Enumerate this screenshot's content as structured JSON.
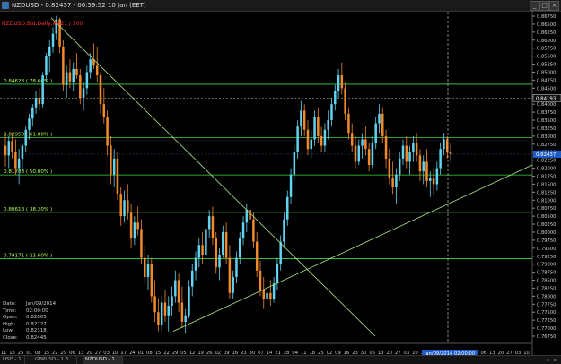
{
  "window": {
    "title": "NZDUSD - 0.82437 - 06:59:52  10 Jan (EET)",
    "controls": [
      "_",
      "□",
      "×"
    ]
  },
  "indicator": {
    "label": "NZDUSD,Bid,Daily,#221 / 300"
  },
  "colors": {
    "background": "#000000",
    "candle_up": "#5fd3ef",
    "candle_down": "#f08a2a",
    "fib_line": "#42d842",
    "fib_label": "#b6ff5a",
    "trendline": "#b0e48c",
    "axis_text": "#d0d0d0",
    "price_marker_bg": "#1d5cc9"
  },
  "fib_levels": [
    {
      "label": "0.84623 ( 78.60% )",
      "price": 0.84623
    },
    {
      "label": "0.82950 ( 61.80% )",
      "price": 0.8295
    },
    {
      "label": "0.81788 ( 50.00% )",
      "price": 0.81788
    },
    {
      "label": "0.80618 ( 38.20% )",
      "price": 0.80618
    },
    {
      "label": "0.79171 ( 23.60% )",
      "price": 0.79171
    }
  ],
  "price_axis": {
    "ticks": [
      "0.86750",
      "0.86500",
      "0.86250",
      "0.86000",
      "0.85750",
      "0.85500",
      "0.85250",
      "0.85000",
      "0.84750",
      "0.84500",
      "0.84250",
      "0.84000",
      "0.83750",
      "0.83500",
      "0.83250",
      "0.83000",
      "0.82750",
      "0.82500",
      "0.82250",
      "0.82000",
      "0.81750",
      "0.81500",
      "0.81250",
      "0.81000",
      "0.80750",
      "0.80500",
      "0.80250",
      "0.80000",
      "0.79750",
      "0.79500",
      "0.79250",
      "0.79000",
      "0.78750",
      "0.78500",
      "0.78250",
      "0.78000",
      "0.77750",
      "0.77500",
      "0.77250",
      "0.77000",
      "0.76750"
    ],
    "marker_upper": "0.84193",
    "marker_current": "0.82437"
  },
  "time_axis": {
    "labels": [
      "11",
      "18",
      "25",
      "01",
      "08",
      "15",
      "22",
      "29",
      "06",
      "13",
      "20",
      "27",
      "03",
      "10",
      "17",
      "24",
      "01",
      "08",
      "15",
      "22",
      "29",
      "05",
      "12",
      "19",
      "26",
      "02",
      "09",
      "16",
      "23",
      "30",
      "07",
      "14",
      "21",
      "28",
      "04",
      "11",
      "18",
      "25",
      "02",
      "09",
      "16",
      "23",
      "30",
      "06",
      "13",
      "20",
      "27",
      "03",
      "10",
      "17",
      "24",
      "01",
      "08",
      "15",
      "22",
      "29",
      "06",
      "13",
      "20",
      "27",
      "03",
      "10"
    ],
    "months": [
      "Jul/08",
      "Aug/05",
      "Sep/02",
      "Oct/07",
      "Nov/04",
      "Dec/02",
      "Jan/06/14",
      "Feb/03",
      "Mar/03"
    ],
    "cursor_label": "Jan/09/2014 02:00:00"
  },
  "data_box": [
    {
      "key": "Date:",
      "value": "Jan/09/2014"
    },
    {
      "key": "Time:",
      "value": "02:00:00"
    },
    {
      "key": "Open:",
      "value": "0.82605"
    },
    {
      "key": "High:",
      "value": "0.82727"
    },
    {
      "key": "Low:",
      "value": "0.82318"
    },
    {
      "key": "Close:",
      "value": "0.82445"
    }
  ],
  "tabs": [
    "USD - 1",
    "GBPUSD - 1.6...",
    "NZDUSD - 1..."
  ],
  "candles": [
    {
      "o": 0.827,
      "h": 0.8308,
      "l": 0.8205,
      "c": 0.824
    },
    {
      "o": 0.824,
      "h": 0.83,
      "l": 0.82,
      "c": 0.8285
    },
    {
      "o": 0.8285,
      "h": 0.831,
      "l": 0.823,
      "c": 0.825
    },
    {
      "o": 0.825,
      "h": 0.829,
      "l": 0.818,
      "c": 0.82
    },
    {
      "o": 0.82,
      "h": 0.826,
      "l": 0.815,
      "c": 0.823
    },
    {
      "o": 0.823,
      "h": 0.828,
      "l": 0.819,
      "c": 0.827
    },
    {
      "o": 0.827,
      "h": 0.833,
      "l": 0.825,
      "c": 0.832
    },
    {
      "o": 0.832,
      "h": 0.837,
      "l": 0.829,
      "c": 0.8355
    },
    {
      "o": 0.8355,
      "h": 0.84,
      "l": 0.833,
      "c": 0.839
    },
    {
      "o": 0.839,
      "h": 0.844,
      "l": 0.837,
      "c": 0.842
    },
    {
      "o": 0.842,
      "h": 0.845,
      "l": 0.838,
      "c": 0.84
    },
    {
      "o": 0.84,
      "h": 0.85,
      "l": 0.839,
      "c": 0.849
    },
    {
      "o": 0.849,
      "h": 0.856,
      "l": 0.847,
      "c": 0.855
    },
    {
      "o": 0.855,
      "h": 0.86,
      "l": 0.85,
      "c": 0.858
    },
    {
      "o": 0.858,
      "h": 0.864,
      "l": 0.856,
      "c": 0.862
    },
    {
      "o": 0.862,
      "h": 0.8676,
      "l": 0.86,
      "c": 0.8665
    },
    {
      "o": 0.8665,
      "h": 0.867,
      "l": 0.856,
      "c": 0.858
    },
    {
      "o": 0.858,
      "h": 0.86,
      "l": 0.844,
      "c": 0.846
    },
    {
      "o": 0.846,
      "h": 0.852,
      "l": 0.842,
      "c": 0.85
    },
    {
      "o": 0.85,
      "h": 0.854,
      "l": 0.845,
      "c": 0.847
    },
    {
      "o": 0.847,
      "h": 0.853,
      "l": 0.844,
      "c": 0.851
    },
    {
      "o": 0.851,
      "h": 0.856,
      "l": 0.848,
      "c": 0.849
    },
    {
      "o": 0.849,
      "h": 0.851,
      "l": 0.84,
      "c": 0.842
    },
    {
      "o": 0.842,
      "h": 0.847,
      "l": 0.838,
      "c": 0.845
    },
    {
      "o": 0.845,
      "h": 0.852,
      "l": 0.843,
      "c": 0.85
    },
    {
      "o": 0.85,
      "h": 0.856,
      "l": 0.848,
      "c": 0.854
    },
    {
      "o": 0.854,
      "h": 0.859,
      "l": 0.851,
      "c": 0.852
    },
    {
      "o": 0.852,
      "h": 0.858,
      "l": 0.847,
      "c": 0.849
    },
    {
      "o": 0.849,
      "h": 0.85,
      "l": 0.837,
      "c": 0.84
    },
    {
      "o": 0.84,
      "h": 0.845,
      "l": 0.834,
      "c": 0.836
    },
    {
      "o": 0.836,
      "h": 0.838,
      "l": 0.824,
      "c": 0.827
    },
    {
      "o": 0.827,
      "h": 0.83,
      "l": 0.815,
      "c": 0.818
    },
    {
      "o": 0.818,
      "h": 0.826,
      "l": 0.814,
      "c": 0.823
    },
    {
      "o": 0.823,
      "h": 0.825,
      "l": 0.81,
      "c": 0.812
    },
    {
      "o": 0.812,
      "h": 0.814,
      "l": 0.802,
      "c": 0.805
    },
    {
      "o": 0.805,
      "h": 0.813,
      "l": 0.803,
      "c": 0.81
    },
    {
      "o": 0.81,
      "h": 0.815,
      "l": 0.804,
      "c": 0.806
    },
    {
      "o": 0.806,
      "h": 0.809,
      "l": 0.795,
      "c": 0.798
    },
    {
      "o": 0.798,
      "h": 0.805,
      "l": 0.796,
      "c": 0.803
    },
    {
      "o": 0.803,
      "h": 0.808,
      "l": 0.799,
      "c": 0.801
    },
    {
      "o": 0.801,
      "h": 0.804,
      "l": 0.79,
      "c": 0.792
    },
    {
      "o": 0.792,
      "h": 0.796,
      "l": 0.784,
      "c": 0.786
    },
    {
      "o": 0.786,
      "h": 0.793,
      "l": 0.782,
      "c": 0.79
    },
    {
      "o": 0.79,
      "h": 0.792,
      "l": 0.778,
      "c": 0.78
    },
    {
      "o": 0.78,
      "h": 0.785,
      "l": 0.772,
      "c": 0.775
    },
    {
      "o": 0.775,
      "h": 0.779,
      "l": 0.769,
      "c": 0.771
    },
    {
      "o": 0.771,
      "h": 0.78,
      "l": 0.769,
      "c": 0.778
    },
    {
      "o": 0.778,
      "h": 0.782,
      "l": 0.772,
      "c": 0.774
    },
    {
      "o": 0.774,
      "h": 0.78,
      "l": 0.769,
      "c": 0.777
    },
    {
      "o": 0.777,
      "h": 0.783,
      "l": 0.774,
      "c": 0.78
    },
    {
      "o": 0.78,
      "h": 0.788,
      "l": 0.778,
      "c": 0.785
    },
    {
      "o": 0.785,
      "h": 0.787,
      "l": 0.775,
      "c": 0.778
    },
    {
      "o": 0.778,
      "h": 0.783,
      "l": 0.77,
      "c": 0.772
    },
    {
      "o": 0.772,
      "h": 0.776,
      "l": 0.7685,
      "c": 0.774
    },
    {
      "o": 0.774,
      "h": 0.785,
      "l": 0.773,
      "c": 0.783
    },
    {
      "o": 0.783,
      "h": 0.79,
      "l": 0.78,
      "c": 0.788
    },
    {
      "o": 0.788,
      "h": 0.794,
      "l": 0.785,
      "c": 0.792
    },
    {
      "o": 0.792,
      "h": 0.798,
      "l": 0.789,
      "c": 0.796
    },
    {
      "o": 0.796,
      "h": 0.8,
      "l": 0.79,
      "c": 0.793
    },
    {
      "o": 0.793,
      "h": 0.803,
      "l": 0.792,
      "c": 0.801
    },
    {
      "o": 0.801,
      "h": 0.807,
      "l": 0.798,
      "c": 0.805
    },
    {
      "o": 0.805,
      "h": 0.808,
      "l": 0.796,
      "c": 0.798
    },
    {
      "o": 0.798,
      "h": 0.8,
      "l": 0.787,
      "c": 0.789
    },
    {
      "o": 0.789,
      "h": 0.795,
      "l": 0.785,
      "c": 0.793
    },
    {
      "o": 0.793,
      "h": 0.802,
      "l": 0.792,
      "c": 0.8
    },
    {
      "o": 0.8,
      "h": 0.803,
      "l": 0.79,
      "c": 0.792
    },
    {
      "o": 0.792,
      "h": 0.796,
      "l": 0.779,
      "c": 0.781
    },
    {
      "o": 0.781,
      "h": 0.788,
      "l": 0.779,
      "c": 0.786
    },
    {
      "o": 0.786,
      "h": 0.794,
      "l": 0.784,
      "c": 0.792
    },
    {
      "o": 0.792,
      "h": 0.8,
      "l": 0.79,
      "c": 0.798
    },
    {
      "o": 0.798,
      "h": 0.805,
      "l": 0.796,
      "c": 0.803
    },
    {
      "o": 0.803,
      "h": 0.809,
      "l": 0.8,
      "c": 0.807
    },
    {
      "o": 0.807,
      "h": 0.81,
      "l": 0.802,
      "c": 0.804
    },
    {
      "o": 0.804,
      "h": 0.806,
      "l": 0.795,
      "c": 0.797
    },
    {
      "o": 0.797,
      "h": 0.8,
      "l": 0.786,
      "c": 0.788
    },
    {
      "o": 0.788,
      "h": 0.791,
      "l": 0.78,
      "c": 0.782
    },
    {
      "o": 0.782,
      "h": 0.786,
      "l": 0.776,
      "c": 0.779
    },
    {
      "o": 0.779,
      "h": 0.783,
      "l": 0.775,
      "c": 0.781
    },
    {
      "o": 0.781,
      "h": 0.785,
      "l": 0.777,
      "c": 0.779
    },
    {
      "o": 0.779,
      "h": 0.786,
      "l": 0.778,
      "c": 0.784
    },
    {
      "o": 0.784,
      "h": 0.792,
      "l": 0.782,
      "c": 0.79
    },
    {
      "o": 0.79,
      "h": 0.799,
      "l": 0.788,
      "c": 0.797
    },
    {
      "o": 0.797,
      "h": 0.806,
      "l": 0.795,
      "c": 0.804
    },
    {
      "o": 0.804,
      "h": 0.813,
      "l": 0.802,
      "c": 0.811
    },
    {
      "o": 0.811,
      "h": 0.82,
      "l": 0.809,
      "c": 0.818
    },
    {
      "o": 0.818,
      "h": 0.827,
      "l": 0.816,
      "c": 0.825
    },
    {
      "o": 0.825,
      "h": 0.835,
      "l": 0.823,
      "c": 0.833
    },
    {
      "o": 0.833,
      "h": 0.841,
      "l": 0.83,
      "c": 0.838
    },
    {
      "o": 0.838,
      "h": 0.84,
      "l": 0.83,
      "c": 0.832
    },
    {
      "o": 0.832,
      "h": 0.835,
      "l": 0.824,
      "c": 0.826
    },
    {
      "o": 0.826,
      "h": 0.832,
      "l": 0.823,
      "c": 0.829
    },
    {
      "o": 0.829,
      "h": 0.838,
      "l": 0.827,
      "c": 0.836
    },
    {
      "o": 0.836,
      "h": 0.839,
      "l": 0.828,
      "c": 0.83
    },
    {
      "o": 0.83,
      "h": 0.833,
      "l": 0.825,
      "c": 0.827
    },
    {
      "o": 0.827,
      "h": 0.834,
      "l": 0.825,
      "c": 0.832
    },
    {
      "o": 0.832,
      "h": 0.838,
      "l": 0.829,
      "c": 0.835
    },
    {
      "o": 0.835,
      "h": 0.842,
      "l": 0.833,
      "c": 0.84
    },
    {
      "o": 0.84,
      "h": 0.846,
      "l": 0.838,
      "c": 0.844
    },
    {
      "o": 0.844,
      "h": 0.851,
      "l": 0.842,
      "c": 0.849
    },
    {
      "o": 0.849,
      "h": 0.853,
      "l": 0.843,
      "c": 0.845
    },
    {
      "o": 0.845,
      "h": 0.847,
      "l": 0.835,
      "c": 0.837
    },
    {
      "o": 0.837,
      "h": 0.839,
      "l": 0.829,
      "c": 0.831
    },
    {
      "o": 0.831,
      "h": 0.834,
      "l": 0.825,
      "c": 0.827
    },
    {
      "o": 0.827,
      "h": 0.83,
      "l": 0.82,
      "c": 0.822
    },
    {
      "o": 0.822,
      "h": 0.829,
      "l": 0.821,
      "c": 0.827
    },
    {
      "o": 0.827,
      "h": 0.831,
      "l": 0.823,
      "c": 0.829
    },
    {
      "o": 0.829,
      "h": 0.833,
      "l": 0.824,
      "c": 0.826
    },
    {
      "o": 0.826,
      "h": 0.828,
      "l": 0.819,
      "c": 0.821
    },
    {
      "o": 0.821,
      "h": 0.83,
      "l": 0.82,
      "c": 0.828
    },
    {
      "o": 0.828,
      "h": 0.836,
      "l": 0.826,
      "c": 0.834
    },
    {
      "o": 0.834,
      "h": 0.84,
      "l": 0.831,
      "c": 0.837
    },
    {
      "o": 0.837,
      "h": 0.839,
      "l": 0.828,
      "c": 0.83
    },
    {
      "o": 0.83,
      "h": 0.832,
      "l": 0.82,
      "c": 0.823
    },
    {
      "o": 0.823,
      "h": 0.826,
      "l": 0.815,
      "c": 0.817
    },
    {
      "o": 0.817,
      "h": 0.822,
      "l": 0.812,
      "c": 0.814
    },
    {
      "o": 0.814,
      "h": 0.82,
      "l": 0.809,
      "c": 0.818
    },
    {
      "o": 0.818,
      "h": 0.825,
      "l": 0.816,
      "c": 0.823
    },
    {
      "o": 0.823,
      "h": 0.829,
      "l": 0.821,
      "c": 0.827
    },
    {
      "o": 0.827,
      "h": 0.83,
      "l": 0.82,
      "c": 0.822
    },
    {
      "o": 0.822,
      "h": 0.827,
      "l": 0.818,
      "c": 0.825
    },
    {
      "o": 0.825,
      "h": 0.83,
      "l": 0.822,
      "c": 0.828
    },
    {
      "o": 0.828,
      "h": 0.831,
      "l": 0.822,
      "c": 0.824
    },
    {
      "o": 0.824,
      "h": 0.826,
      "l": 0.816,
      "c": 0.819
    },
    {
      "o": 0.819,
      "h": 0.824,
      "l": 0.815,
      "c": 0.822
    },
    {
      "o": 0.822,
      "h": 0.826,
      "l": 0.814,
      "c": 0.816
    },
    {
      "o": 0.816,
      "h": 0.819,
      "l": 0.811,
      "c": 0.817
    },
    {
      "o": 0.817,
      "h": 0.82,
      "l": 0.812,
      "c": 0.815
    },
    {
      "o": 0.815,
      "h": 0.822,
      "l": 0.813,
      "c": 0.82
    },
    {
      "o": 0.82,
      "h": 0.828,
      "l": 0.818,
      "c": 0.826
    },
    {
      "o": 0.826,
      "h": 0.831,
      "l": 0.824,
      "c": 0.829
    },
    {
      "o": 0.829,
      "h": 0.83,
      "l": 0.823,
      "c": 0.825
    },
    {
      "o": 0.825,
      "h": 0.828,
      "l": 0.822,
      "c": 0.8244
    }
  ]
}
